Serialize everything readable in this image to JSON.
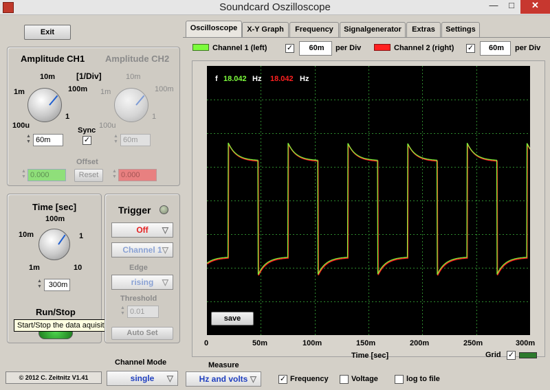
{
  "window": {
    "title": "Soundcard Oszilloscope",
    "minimize": "—",
    "maximize": "□",
    "close": "✕"
  },
  "left": {
    "exit_label": "Exit",
    "amp1_title": "Amplitude CH1",
    "amp2_title": "Amplitude CH2",
    "per_div": "[1/Div]",
    "amp_ticks": {
      "a": "10m",
      "b": "100m",
      "c": "1m",
      "d": "1",
      "e": "100u"
    },
    "ch1_value": "60m",
    "ch2_value": "60m",
    "sync_label": "Sync",
    "offset_label": "Offset",
    "offset_ch1": "0.000",
    "offset_ch2": "0.000",
    "reset_label": "Reset",
    "time_title": "Time [sec]",
    "time_ticks": {
      "a": "100m",
      "b": "10m",
      "c": "1",
      "d": "1m",
      "e": "10"
    },
    "time_value": "300m",
    "runstop_title": "Run/Stop",
    "tooltip": "Start/Stop the data aquisition",
    "copyright": "© 2012  C. Zeitnitz V1.41"
  },
  "trigger": {
    "title": "Trigger",
    "mode": "Off",
    "channel": "Channel 1",
    "edge_label": "Edge",
    "edge": "rising",
    "threshold_label": "Threshold",
    "threshold": "0.01",
    "autoset": "Auto Set"
  },
  "channel_mode": {
    "title": "Channel Mode",
    "value": "single"
  },
  "tabs": [
    "Oscilloscope",
    "X-Y Graph",
    "Frequency",
    "Signalgenerator",
    "Extras",
    "Settings"
  ],
  "channels": {
    "ch1_label": "Channel 1 (left)",
    "ch1_div": "60m",
    "ch2_label": "Channel 2 (right)",
    "ch2_div": "60m",
    "per_div": "per Div",
    "ch1_color": "#7cfc3c",
    "ch2_color": "#ff2020"
  },
  "scope": {
    "freq_f": "f",
    "freq_ch1": "18.042",
    "freq_ch2": "18.042",
    "hz": "Hz",
    "save_label": "save",
    "x_ticks": [
      "0",
      "50m",
      "100m",
      "150m",
      "200m",
      "250m",
      "300m"
    ],
    "xlabel": "Time [sec]",
    "grid_label": "Grid",
    "grid_on": "✓"
  },
  "measure": {
    "title": "Measure",
    "mode": "Hz and volts",
    "frequency_label": "Frequency",
    "voltage_label": "Voltage",
    "log_label": "log to file",
    "frequency_checked": "✓"
  }
}
